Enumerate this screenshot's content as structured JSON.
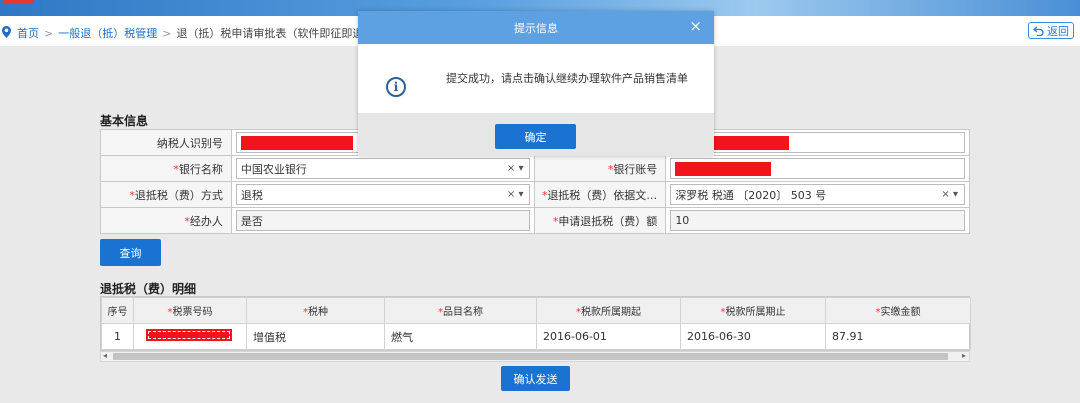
{
  "breadcrumb": {
    "home": "首页",
    "level1": "一般退（抵）税管理",
    "current": "退（抵）税申请审批表（软件即征即退）",
    "separator": ">"
  },
  "back_button": "返回",
  "basic_info": {
    "title": "基本信息",
    "taxpayer_id_label": "纳税人识别号",
    "bank_name_label": "银行名称",
    "bank_name_value": "中国农业银行",
    "bank_account_label": "银行账号",
    "refund_method_label": "退抵税（费）方式",
    "refund_method_value": "退税",
    "refund_basis_label": "退抵税（费）依据文…",
    "refund_basis_value": "深罗税 税通 〔2020〕 503 号",
    "handler_label": "经办人",
    "handler_value": "是否",
    "amount_label": "申请退抵税（费）额",
    "amount_value": "10",
    "required_mark": "*"
  },
  "query_button": "查询",
  "detail": {
    "title": "退抵税（费）明细",
    "columns": [
      "序号",
      "税票号码",
      "税种",
      "品目名称",
      "税款所属期起",
      "税款所属期止",
      "实缴金额"
    ],
    "rows": [
      {
        "index": "1",
        "tax_type": "增值税",
        "item": "燃气",
        "period_start": "2016-06-01",
        "period_end": "2016-06-30",
        "amount": "87.91"
      }
    ]
  },
  "confirm_send_button": "确认发送",
  "modal": {
    "title": "提示信息",
    "message": "提交成功，请点击确认继续办理软件产品销售清单",
    "ok_button": "确定",
    "close_glyph": "×"
  },
  "colors": {
    "primary": "#1a73d1",
    "modal_header": "#5da1e3",
    "required": "#e33333",
    "redaction": "#f2141d"
  }
}
